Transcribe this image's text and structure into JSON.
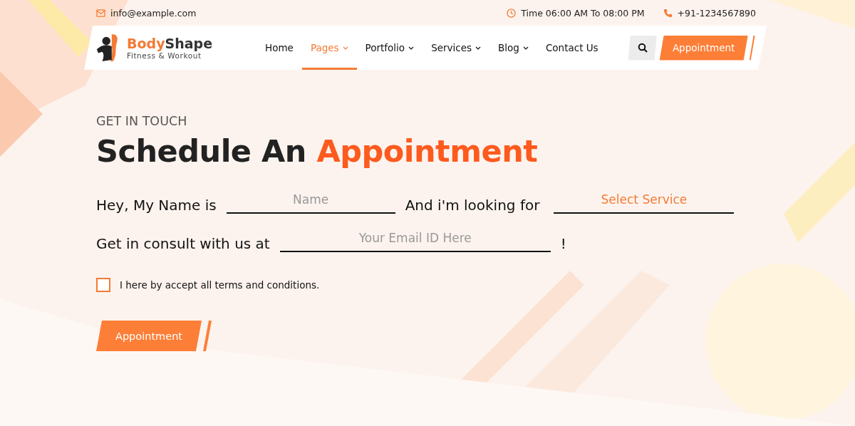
{
  "topbar": {
    "email": "info@example.com",
    "hours": "Time 06:00 AM To 08:00 PM",
    "phone": "+91-1234567890"
  },
  "logo": {
    "name_first": "Body",
    "name_second": "Shape",
    "tagline": "Fitness & Workout"
  },
  "nav": [
    {
      "label": "Home",
      "selected": false,
      "dropdown": false
    },
    {
      "label": "Pages",
      "selected": true,
      "dropdown": true
    },
    {
      "label": "Portfolio",
      "selected": false,
      "dropdown": true
    },
    {
      "label": "Services",
      "selected": false,
      "dropdown": true
    },
    {
      "label": "Blog",
      "selected": false,
      "dropdown": true
    },
    {
      "label": "Contact Us",
      "selected": false,
      "dropdown": false
    }
  ],
  "header_button": "Appointment",
  "section": {
    "eyebrow": "GET IN TOUCH",
    "title_plain": "Schedule An ",
    "title_accent": "Appointment"
  },
  "form": {
    "name_lead": "Hey, My Name is",
    "name_placeholder": "Name",
    "service_lead": "And i'm looking for",
    "service_select": "Select Service",
    "email_lead": "Get in consult with us at",
    "email_placeholder": "Your Email ID Here",
    "email_tail": "!",
    "terms": {
      "label": "I here by accept all terms and conditions.",
      "checked": false
    },
    "submit": "Appointment"
  }
}
